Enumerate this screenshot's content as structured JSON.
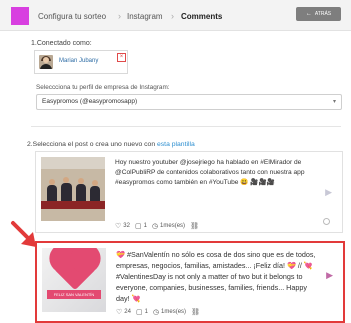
{
  "header": {
    "breadcrumbs": [
      "Configura tu sorteo",
      "Instagram",
      "Comments"
    ],
    "back_label": "ATRÁS",
    "brand_color": "#d83fe0"
  },
  "step1": {
    "label": "1.Conectado como:",
    "user_name": "Marian Jubany",
    "select_label": "Seleccciona tu perfil de empresa de Instagram:",
    "select_value": "Easypromos (@easypromosapp)"
  },
  "step2": {
    "label": "2.Selecciona el post o crea uno nuevo con",
    "link": "esta plantilla"
  },
  "posts": [
    {
      "text": "Hoy nuestro youtuber @josejriego ha hablado en #ElMirador de @ColPubliRP de contenidos colaborativos tanto con nuestra app #easypromos como también en #YouTube 😃 🎥🎥🎥",
      "likes": "32",
      "comments": "1",
      "time": "1mes(es)",
      "selected": false
    },
    {
      "text": "💝 #SanValentín no sólo es cosa de dos sino que es de todos, empresas, negocios, familias, amistades... ¡Feliz día! 💝 // 💘 #ValentinesDay is not only a matter of two but it belongs to everyone, companies, businesses, families, friends... Happy day! 💘",
      "likes": "24",
      "comments": "1",
      "time": "1mes(es)",
      "selected": true,
      "image_caption": "FELIZ SAN VALENTÍN"
    }
  ],
  "colors": {
    "selected_border": "#e23a3a",
    "arrow": "#e23a3a",
    "link": "#2d8fd0"
  }
}
